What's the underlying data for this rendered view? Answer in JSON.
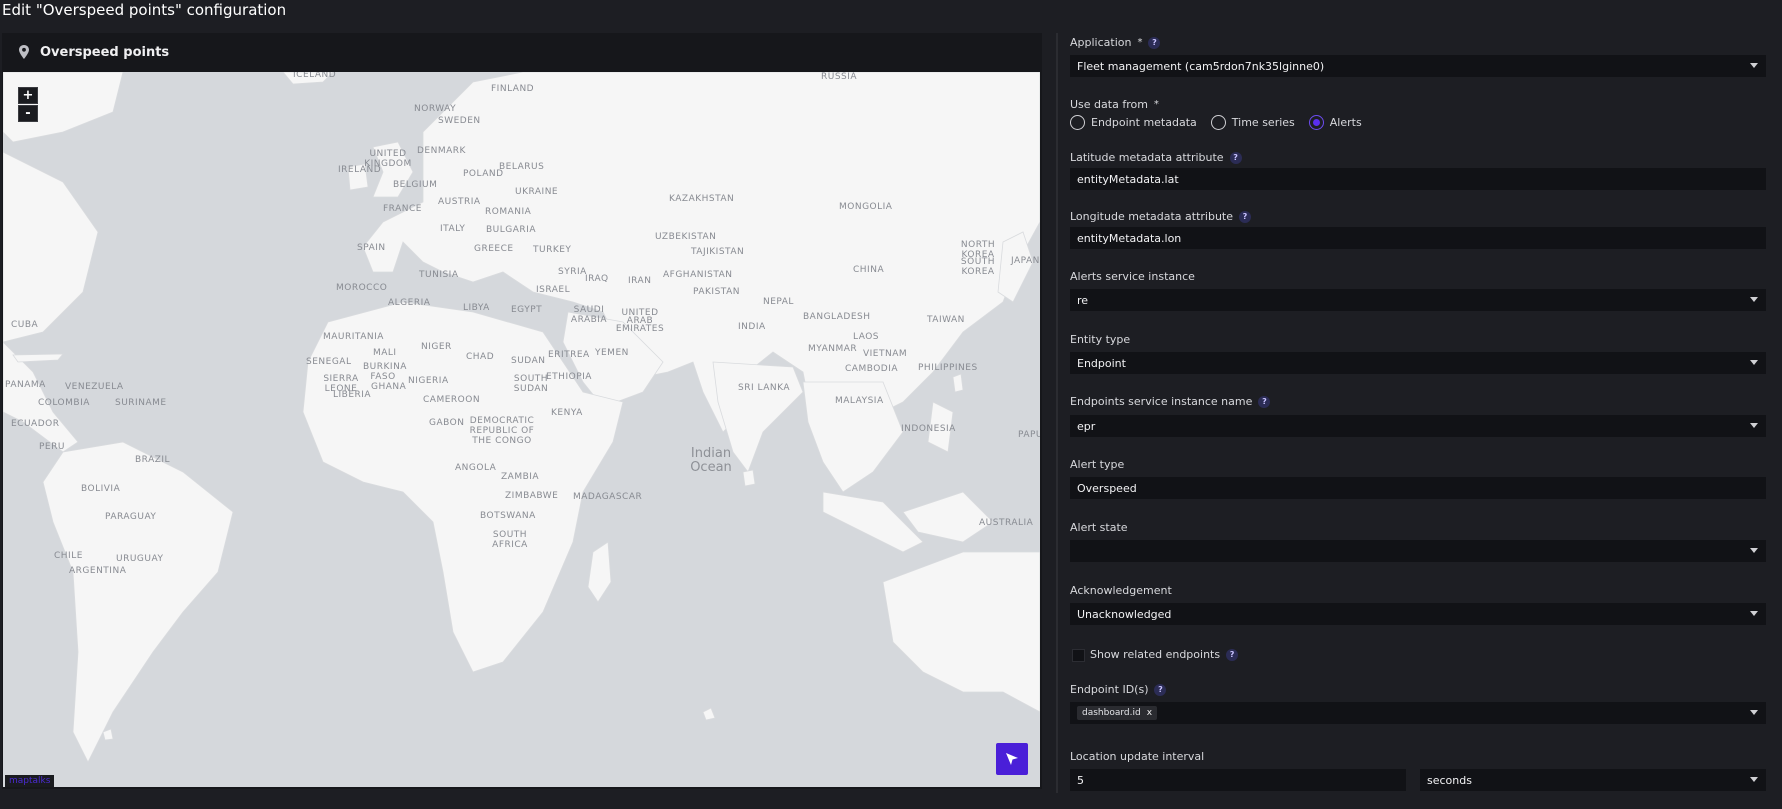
{
  "page": {
    "title": "Edit \"Overspeed points\" configuration"
  },
  "widget": {
    "title": "Overspeed points",
    "zoom_in": "+",
    "zoom_out": "-",
    "attribution": "maptalks",
    "map_labels": {
      "iceland": "ICELAND",
      "finland": "FINLAND",
      "russia": "RUSSIA",
      "norway": "NORWAY",
      "sweden": "SWEDEN",
      "denmark": "DENMARK",
      "united_kingdom": "UNITED KINGDOM",
      "ireland": "IRELAND",
      "poland": "POLAND",
      "belarus": "BELARUS",
      "belgium": "BELGIUM",
      "ukraine": "UKRAINE",
      "austria": "AUSTRIA",
      "romania": "ROMANIA",
      "france": "FRANCE",
      "kazakhstan": "KAZAKHSTAN",
      "mongolia": "MONGOLIA",
      "italy": "ITALY",
      "bulgaria": "BULGARIA",
      "spain": "SPAIN",
      "greece": "GREECE",
      "turkey": "TURKEY",
      "uzbekistan": "UZBEKISTAN",
      "tajikistan": "TAJIKISTAN",
      "north_korea": "NORTH KOREA",
      "south_korea": "SOUTH KOREA",
      "japan": "JAPAN",
      "tunisia": "TUNISIA",
      "syria": "SYRIA",
      "iraq": "IRAQ",
      "iran": "IRAN",
      "afghanistan": "AFGHANISTAN",
      "china": "CHINA",
      "morocco": "MOROCCO",
      "algeria": "ALGERIA",
      "libya": "LIBYA",
      "egypt": "EGYPT",
      "israel": "ISRAEL",
      "saudi_arabia": "SAUDI ARABIA",
      "uae": "UNITED ARAB EMIRATES",
      "pakistan": "PAKISTAN",
      "nepal": "NEPAL",
      "bangladesh": "BANGLADESH",
      "taiwan": "TAIWAN",
      "cuba": "CUBA",
      "mauritania": "MAURITANIA",
      "mali": "MALI",
      "niger": "NIGER",
      "india": "INDIA",
      "laos": "LAOS",
      "myanmar": "MYANMAR",
      "vietnam": "VIETNAM",
      "eritrea": "ERITREA",
      "yemen": "YEMEN",
      "senegal": "SENEGAL",
      "burkina_faso": "BURKINA FASO",
      "chad": "CHAD",
      "sudan": "SUDAN",
      "cambodia": "CAMBODIA",
      "philippines": "PHILIPPINES",
      "panama": "PANAMA",
      "venezuela": "VENEZUELA",
      "sierra_leone": "SIERRA LEONE",
      "liberia": "LIBERIA",
      "ghana": "GHANA",
      "nigeria": "NIGERIA",
      "south_sudan": "SOUTH SUDAN",
      "ethiopia": "ETHIOPIA",
      "sri_lanka": "SRI LANKA",
      "colombia": "COLOMBIA",
      "suriname": "SURINAME",
      "cameroon": "CAMEROON",
      "malaysia": "MALAYSIA",
      "kenya": "KENYA",
      "ecuador": "ECUADOR",
      "gabon": "GABON",
      "drc": "DEMOCRATIC REPUBLIC OF THE CONGO",
      "indonesia": "INDONESIA",
      "papua": "PAPU",
      "peru": "PERU",
      "brazil": "BRAZIL",
      "angola": "ANGOLA",
      "zambia": "ZAMBIA",
      "bolivia": "BOLIVIA",
      "zimbabwe": "ZIMBABWE",
      "madagascar": "MADAGASCAR",
      "australia": "AUSTRALIA",
      "paraguay": "PARAGUAY",
      "botswana": "BOTSWANA",
      "south_africa": "SOUTH AFRICA",
      "chile": "CHILE",
      "uruguay": "URUGUAY",
      "argentina": "ARGENTINA",
      "indian_ocean": "Indian Ocean"
    }
  },
  "form": {
    "application": {
      "label": "Application",
      "value": "Fleet management (cam5rdon7nk35lginne0)"
    },
    "use_data_from": {
      "label": "Use data from",
      "options": [
        "Endpoint metadata",
        "Time series",
        "Alerts"
      ],
      "selected": "Alerts"
    },
    "latitude": {
      "label": "Latitude metadata attribute",
      "value": "entityMetadata.lat"
    },
    "longitude": {
      "label": "Longitude metadata attribute",
      "value": "entityMetadata.lon"
    },
    "alerts_service": {
      "label": "Alerts service instance",
      "value": "re"
    },
    "entity_type": {
      "label": "Entity type",
      "value": "Endpoint"
    },
    "endpoints_service": {
      "label": "Endpoints service instance name",
      "value": "epr"
    },
    "alert_type": {
      "label": "Alert type",
      "value": "Overspeed"
    },
    "alert_state": {
      "label": "Alert state",
      "value": ""
    },
    "acknowledgement": {
      "label": "Acknowledgement",
      "value": "Unacknowledged"
    },
    "show_related": {
      "label": "Show related endpoints",
      "checked": false
    },
    "endpoint_ids": {
      "label": "Endpoint ID(s)",
      "chip": "dashboard.id",
      "chip_remove": "x"
    },
    "location_interval": {
      "label": "Location update interval",
      "value": "5",
      "unit": "seconds"
    }
  },
  "colors": {
    "accent": "#4a1fd8",
    "background": "#1d1e23",
    "panel": "#16171b",
    "input": "#111216",
    "land": "#f5f5f5",
    "water": "#d5d8dc"
  }
}
